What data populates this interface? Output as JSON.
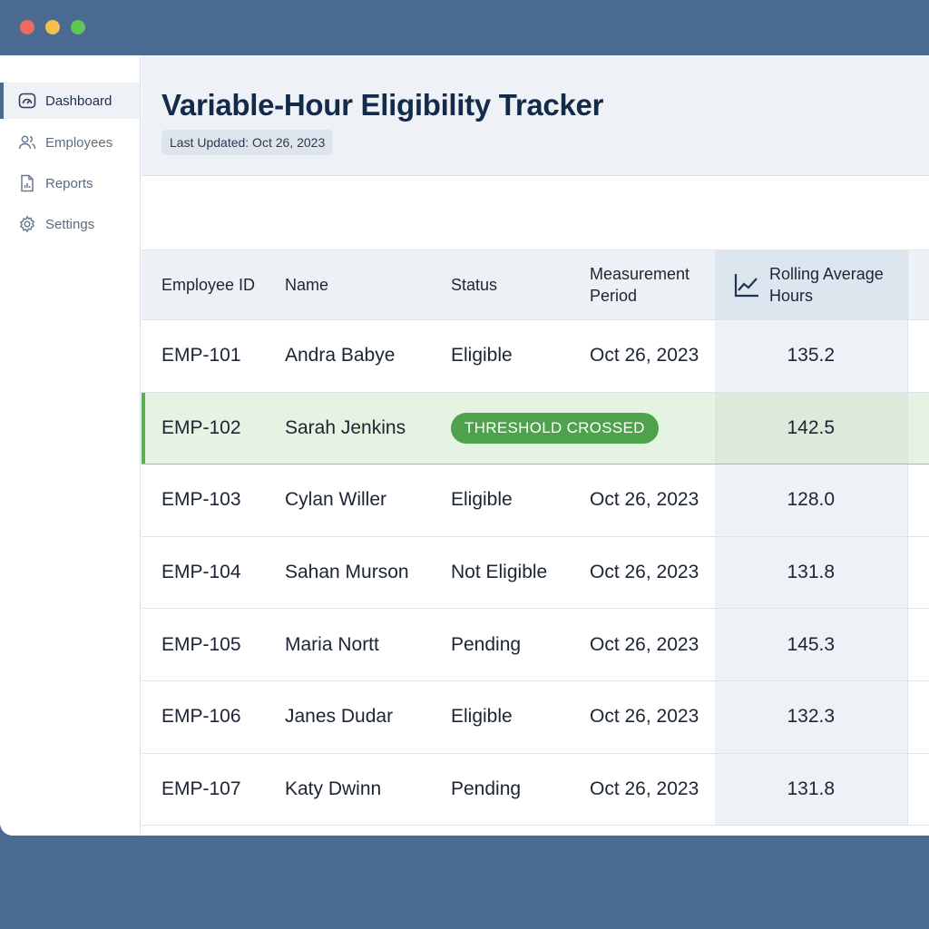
{
  "sidebar": {
    "items": [
      {
        "label": "Dashboard",
        "icon": "gauge-icon",
        "active": true
      },
      {
        "label": "Employees",
        "icon": "users-icon",
        "active": false
      },
      {
        "label": "Reports",
        "icon": "report-icon",
        "active": false
      },
      {
        "label": "Settings",
        "icon": "gear-icon",
        "active": false
      }
    ]
  },
  "header": {
    "title": "Variable-Hour Eligibility Tracker",
    "last_updated": "Last Updated: Oct 26, 2023"
  },
  "table": {
    "columns": {
      "id": "Employee ID",
      "name": "Name",
      "status": "Status",
      "period": "Measurement Period",
      "avg": "Rolling Average Hours",
      "avg_icon": "trend-chart-icon"
    },
    "rows": [
      {
        "id": "EMP-101",
        "name": "Andra Babye",
        "status": "Eligible",
        "period": "Oct 26, 2023",
        "avg": "135.2"
      },
      {
        "id": "EMP-102",
        "name": "Sarah Jenkins",
        "status": "THRESHOLD CROSSED",
        "period": "",
        "avg": "142.5"
      },
      {
        "id": "EMP-103",
        "name": "Cylan Willer",
        "status": "Eligible",
        "period": "Oct 26, 2023",
        "avg": "128.0"
      },
      {
        "id": "EMP-104",
        "name": "Sahan Murson",
        "status": "Not Eligible",
        "period": "Oct 26, 2023",
        "avg": "131.8"
      },
      {
        "id": "EMP-105",
        "name": "Maria Nortt",
        "status": "Pending",
        "period": "Oct 26, 2023",
        "avg": "145.3"
      },
      {
        "id": "EMP-106",
        "name": "Janes Dudar",
        "status": "Eligible",
        "period": "Oct 26, 2023",
        "avg": "132.3"
      },
      {
        "id": "EMP-107",
        "name": "Katy Dwinn",
        "status": "Pending",
        "period": "Oct 26, 2023",
        "avg": "131.8"
      }
    ]
  },
  "colors": {
    "frame": "#4a6a92",
    "title": "#142a4a",
    "highlight_row": "#e5f3e2",
    "threshold_badge": "#4fa24c"
  }
}
